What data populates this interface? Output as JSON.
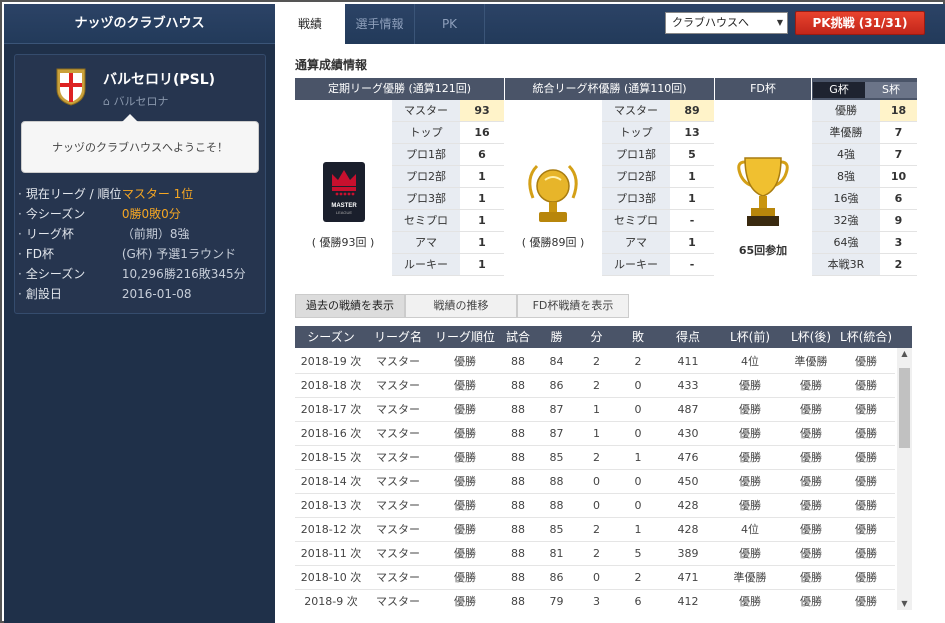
{
  "sidebar": {
    "title": "ナッヅのクラブハウス",
    "club_name": "バルセロリ(PSL)",
    "club_city": "バルセロナ",
    "welcome": "ナッヅのクラブハウスへようこそ！",
    "info": [
      {
        "label": "現在リーグ / 順位",
        "value": "マスター 1位",
        "accent": true
      },
      {
        "label": "今シーズン",
        "value": "0勝0敗0分",
        "accent": true
      },
      {
        "label": "リーグ杯",
        "value": "（前期）8強",
        "accent": false
      },
      {
        "label": "FD杯",
        "value": "(G杯) 予選1ラウンド",
        "accent": false
      },
      {
        "label": "全シーズン",
        "value": "10,296勝216敗345分",
        "accent": false
      },
      {
        "label": "創設日",
        "value": "2016-01-08",
        "accent": false
      }
    ]
  },
  "topbar": {
    "tabs": [
      "戦績",
      "選手情報",
      "PK"
    ],
    "select_value": "クラブハウスへ",
    "pk_button": "PK挑戦 (31/31)"
  },
  "summary": {
    "title": "通算成績情報",
    "league_head": "定期リーグ優勝 (通算121回)",
    "cup_head": "統合リーグ杯優勝 (通算110回)",
    "fd_head": "FD杯",
    "g_tab": "G杯",
    "s_tab": "S杯",
    "league_caption": "( 優勝93回 )",
    "league_badge_line1": "MASTER",
    "league_badge_line2": "LEAGUE",
    "cup_caption": "( 優勝89回 )",
    "fd_caption": "65回参加",
    "league_ranks": [
      {
        "label": "マスター",
        "value": "93"
      },
      {
        "label": "トップ",
        "value": "16"
      },
      {
        "label": "プロ1部",
        "value": "6"
      },
      {
        "label": "プロ2部",
        "value": "1"
      },
      {
        "label": "プロ3部",
        "value": "1"
      },
      {
        "label": "セミプロ",
        "value": "1"
      },
      {
        "label": "アマ",
        "value": "1"
      },
      {
        "label": "ルーキー",
        "value": "1"
      }
    ],
    "cup_ranks": [
      {
        "label": "マスター",
        "value": "89"
      },
      {
        "label": "トップ",
        "value": "13"
      },
      {
        "label": "プロ1部",
        "value": "5"
      },
      {
        "label": "プロ2部",
        "value": "1"
      },
      {
        "label": "プロ3部",
        "value": "1"
      },
      {
        "label": "セミプロ",
        "value": "-"
      },
      {
        "label": "アマ",
        "value": "1"
      },
      {
        "label": "ルーキー",
        "value": "-"
      }
    ],
    "fd_ranks": [
      {
        "label": "優勝",
        "value": "18"
      },
      {
        "label": "準優勝",
        "value": "7"
      },
      {
        "label": "4強",
        "value": "7"
      },
      {
        "label": "8強",
        "value": "10"
      },
      {
        "label": "16強",
        "value": "6"
      },
      {
        "label": "32強",
        "value": "9"
      },
      {
        "label": "64強",
        "value": "3"
      },
      {
        "label": "本戦3R",
        "value": "2"
      }
    ]
  },
  "buttons": [
    "過去の戦績を表示",
    "戦績の推移",
    "FD杯戦績を表示"
  ],
  "history": {
    "columns": [
      "シーズン",
      "リーグ名",
      "リーグ順位",
      "試合",
      "勝",
      "分",
      "敗",
      "得点",
      "L杯(前)",
      "L杯(後)",
      "L杯(統合)"
    ],
    "rows": [
      [
        "2018-19 次",
        "マスター",
        "優勝",
        "88",
        "84",
        "2",
        "2",
        "411",
        "4位",
        "準優勝",
        "優勝"
      ],
      [
        "2018-18 次",
        "マスター",
        "優勝",
        "88",
        "86",
        "2",
        "0",
        "433",
        "優勝",
        "優勝",
        "優勝"
      ],
      [
        "2018-17 次",
        "マスター",
        "優勝",
        "88",
        "87",
        "1",
        "0",
        "487",
        "優勝",
        "優勝",
        "優勝"
      ],
      [
        "2018-16 次",
        "マスター",
        "優勝",
        "88",
        "87",
        "1",
        "0",
        "430",
        "優勝",
        "優勝",
        "優勝"
      ],
      [
        "2018-15 次",
        "マスター",
        "優勝",
        "88",
        "85",
        "2",
        "1",
        "476",
        "優勝",
        "優勝",
        "優勝"
      ],
      [
        "2018-14 次",
        "マスター",
        "優勝",
        "88",
        "88",
        "0",
        "0",
        "450",
        "優勝",
        "優勝",
        "優勝"
      ],
      [
        "2018-13 次",
        "マスター",
        "優勝",
        "88",
        "88",
        "0",
        "0",
        "428",
        "優勝",
        "優勝",
        "優勝"
      ],
      [
        "2018-12 次",
        "マスター",
        "優勝",
        "88",
        "85",
        "2",
        "1",
        "428",
        "4位",
        "優勝",
        "優勝"
      ],
      [
        "2018-11 次",
        "マスター",
        "優勝",
        "88",
        "81",
        "2",
        "5",
        "389",
        "優勝",
        "優勝",
        "優勝"
      ],
      [
        "2018-10 次",
        "マスター",
        "優勝",
        "88",
        "86",
        "0",
        "2",
        "471",
        "準優勝",
        "優勝",
        "優勝"
      ],
      [
        "2018-9 次",
        "マスター",
        "優勝",
        "88",
        "79",
        "3",
        "6",
        "412",
        "優勝",
        "優勝",
        "優勝"
      ]
    ]
  },
  "colors": {
    "accent_orange": "#f5a623",
    "pk_red": "#d9321f",
    "header_gray": "#4a5468"
  }
}
